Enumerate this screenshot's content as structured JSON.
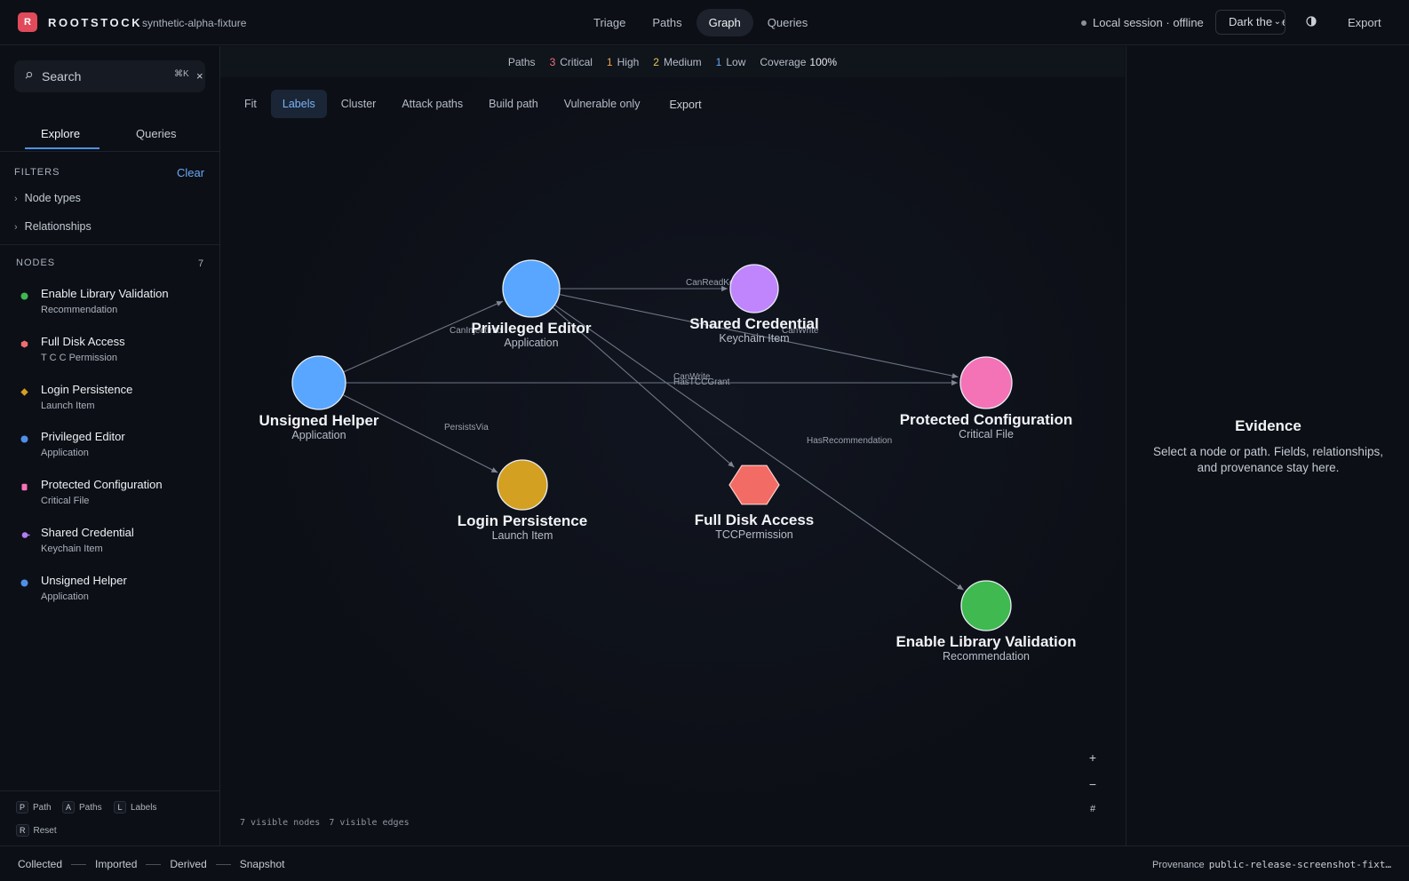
{
  "app": {
    "logo_letter": "R",
    "brand": "ROOTSTOCK",
    "fixture": "synthetic-alpha-fixture",
    "accent": "#e04a5a"
  },
  "nav": {
    "tabs": [
      {
        "label": "Triage"
      },
      {
        "label": "Paths"
      },
      {
        "label": "Graph",
        "active": true
      },
      {
        "label": "Queries"
      }
    ]
  },
  "session": {
    "status": "Local session · offline",
    "theme": "Dark theme",
    "export_label": "Export"
  },
  "sidebar": {
    "search_placeholder": "Search",
    "search_shortcut": "⌘K",
    "clear_icon": "×",
    "tabs": {
      "explore": "Explore",
      "queries": "Queries"
    },
    "filters_label": "FILTERS",
    "clear_label": "Clear",
    "filters": [
      "Node types",
      "Relationships"
    ],
    "nodes_label": "NODES",
    "nodes_count": "7",
    "nodes": [
      {
        "name": "Enable Library Validation",
        "type": "Recommendation",
        "icon": "recommendation-icon",
        "color": "#3fb950"
      },
      {
        "name": "Full Disk Access",
        "type": "T C C Permission",
        "icon": "permission-icon",
        "color": "#f06e6e"
      },
      {
        "name": "Login Persistence",
        "type": "Launch Item",
        "icon": "launch-item-icon",
        "color": "#d4a022"
      },
      {
        "name": "Privileged Editor",
        "type": "Application",
        "icon": "application-icon",
        "color": "#4f8fe8"
      },
      {
        "name": "Protected Configuration",
        "type": "Critical File",
        "icon": "critical-file-icon",
        "color": "#f472b6"
      },
      {
        "name": "Shared Credential",
        "type": "Keychain Item",
        "icon": "keychain-icon",
        "color": "#b37cf6"
      },
      {
        "name": "Unsigned Helper",
        "type": "Application",
        "icon": "application-icon",
        "color": "#4f8fe8"
      }
    ],
    "shortcuts": [
      {
        "key": "P",
        "label": "Path"
      },
      {
        "key": "A",
        "label": "Paths"
      },
      {
        "key": "L",
        "label": "Labels"
      },
      {
        "key": "R",
        "label": "Reset"
      }
    ]
  },
  "summary": {
    "paths_label": "Paths",
    "critical": {
      "count": "3",
      "label": "Critical"
    },
    "high": {
      "count": "1",
      "label": "High"
    },
    "medium": {
      "count": "2",
      "label": "Medium"
    },
    "low": {
      "count": "1",
      "label": "Low"
    },
    "coverage_label": "Coverage",
    "coverage_value": "100%"
  },
  "toolbar": {
    "fit": "Fit",
    "labels": "Labels",
    "cluster": "Cluster",
    "attack_paths": "Attack paths",
    "build_path": "Build path",
    "vulnerable_only": "Vulnerable only",
    "export": "Export"
  },
  "graph": {
    "nodes": [
      {
        "id": "unsigned",
        "label": "Unsigned Helper",
        "sublabel": "Application",
        "shape": "circle",
        "color": "#58a6ff"
      },
      {
        "id": "editor",
        "label": "Privileged Editor",
        "sublabel": "Application",
        "shape": "circle",
        "color": "#58a6ff"
      },
      {
        "id": "credential",
        "label": "Shared Credential",
        "sublabel": "Keychain Item",
        "shape": "circle",
        "color": "#c084fc"
      },
      {
        "id": "config",
        "label": "Protected Configuration",
        "sublabel": "Critical File",
        "shape": "circle",
        "color": "#f472b6"
      },
      {
        "id": "login",
        "label": "Login Persistence",
        "sublabel": "Launch Item",
        "shape": "circle",
        "color": "#d4a022"
      },
      {
        "id": "fda",
        "label": "Full Disk Access",
        "sublabel": "TCCPermission",
        "shape": "hexagon",
        "color": "#f26b64"
      },
      {
        "id": "elv",
        "label": "Enable Library Validation",
        "sublabel": "Recommendation",
        "shape": "circle",
        "color": "#3fb950"
      }
    ],
    "edges": [
      {
        "from": "unsigned",
        "to": "editor",
        "label": "CanInjectInto"
      },
      {
        "from": "unsigned",
        "to": "config",
        "label": "HasTCCGrant"
      },
      {
        "from": "unsigned",
        "to": "login",
        "label": "PersistsVia"
      },
      {
        "from": "editor",
        "to": "credential",
        "label": "CanReadKeychain"
      },
      {
        "from": "editor",
        "to": "config",
        "label": "CanWrite"
      },
      {
        "from": "editor",
        "to": "fda",
        "label": "CanWrite"
      },
      {
        "from": "editor",
        "to": "elv",
        "label": "HasRecommendation"
      }
    ],
    "zoom_in": "+",
    "zoom_out": "−",
    "grid": "#",
    "visible_nodes": "7 visible nodes",
    "visible_edges": "7 visible edges"
  },
  "evidence": {
    "title": "Evidence",
    "body": "Select a node or path. Fields, relationships, and provenance stay here."
  },
  "footer": {
    "legend": [
      "Collected",
      "Imported",
      "Derived",
      "Snapshot"
    ],
    "provenance_label": "Provenance",
    "provenance_value": "public-release-screenshot-fixt…"
  }
}
